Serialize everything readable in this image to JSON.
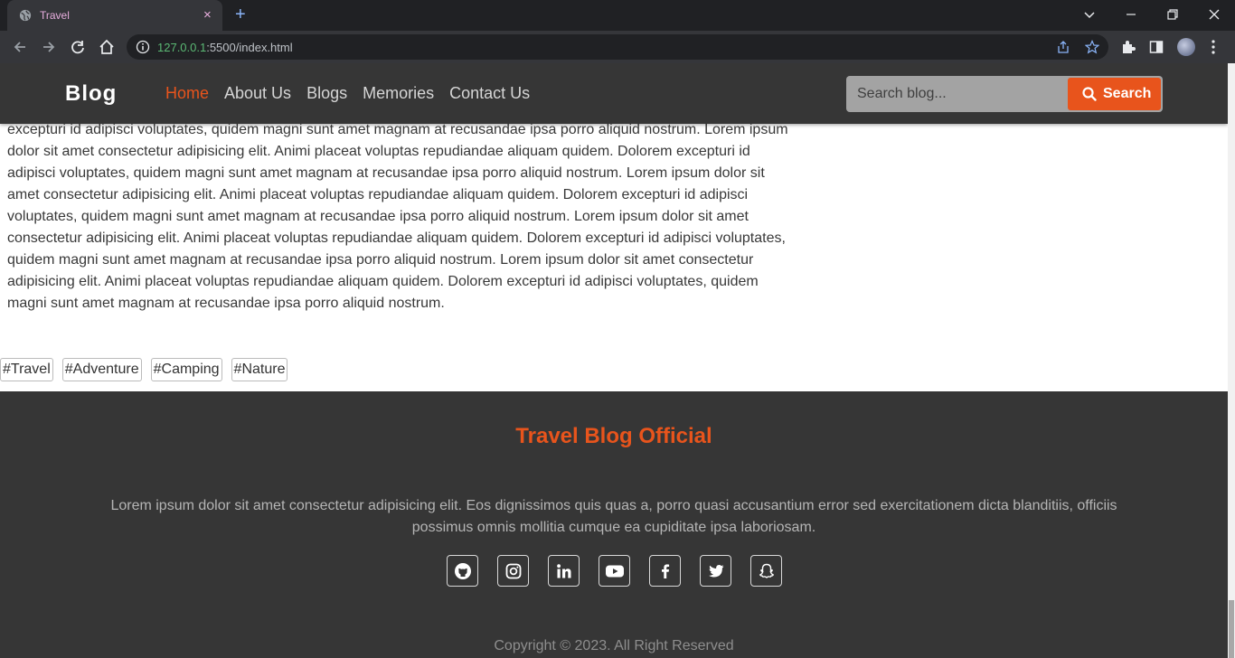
{
  "browser": {
    "tab_title": "Travel",
    "url_host": "127.0.0.1",
    "url_rest": ":5500/index.html",
    "new_tab_glyph": "+",
    "close_glyph": "×"
  },
  "site": {
    "brand": "Blog",
    "nav": [
      "Home",
      "About Us",
      "Blogs",
      "Memories",
      "Contact Us"
    ],
    "active_nav": "Home",
    "accent_color": "#e8541c",
    "search": {
      "placeholder": "Search blog...",
      "button_label": "Search"
    }
  },
  "article": {
    "text": "excepturi id adipisci voluptates, quidem magni sunt amet magnam at recusandae ipsa porro aliquid nostrum. Lorem ipsum dolor sit amet consectetur adipisicing elit. Animi placeat voluptas repudiandae aliquam quidem. Dolorem excepturi id adipisci voluptates, quidem magni sunt amet magnam at recusandae ipsa porro aliquid nostrum. Lorem ipsum dolor sit amet consectetur adipisicing elit. Animi placeat voluptas repudiandae aliquam quidem. Dolorem excepturi id adipisci voluptates, quidem magni sunt amet magnam at recusandae ipsa porro aliquid nostrum. Lorem ipsum dolor sit amet consectetur adipisicing elit. Animi placeat voluptas repudiandae aliquam quidem. Dolorem excepturi id adipisci voluptates, quidem magni sunt amet magnam at recusandae ipsa porro aliquid nostrum. Lorem ipsum dolor sit amet consectetur adipisicing elit. Animi placeat voluptas repudiandae aliquam quidem. Dolorem excepturi id adipisci voluptates, quidem magni sunt amet magnam at recusandae ipsa porro aliquid nostrum.",
    "tags": [
      "#Travel",
      "#Adventure",
      "#Camping",
      "#Nature"
    ]
  },
  "footer": {
    "title": "Travel Blog Official",
    "text": "Lorem ipsum dolor sit amet consectetur adipisicing elit. Eos dignissimos quis quas a, porro quasi accusantium error sed exercitationem dicta blanditiis, officiis possimus omnis mollitia cumque ea cupiditate ipsa laboriosam.",
    "socials": [
      "github-icon",
      "instagram-icon",
      "linkedin-icon",
      "youtube-icon",
      "facebook-icon",
      "twitter-icon",
      "snapchat-icon"
    ],
    "copyright": "Copyright © 2023. All Right Reserved"
  }
}
